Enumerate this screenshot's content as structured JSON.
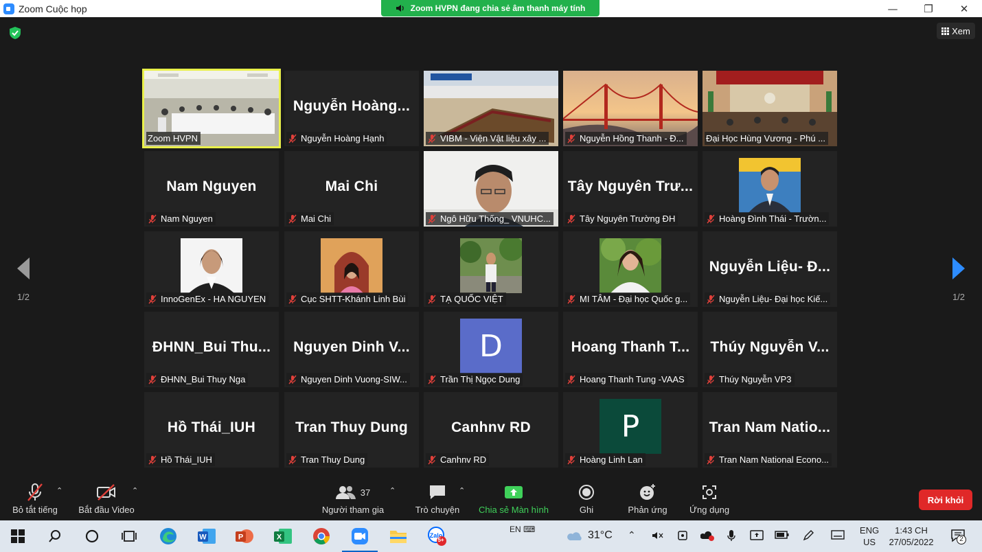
{
  "window": {
    "title": "Zoom Cuộc họp"
  },
  "banner": {
    "text": "Zoom HVPN đang chia sẻ âm thanh máy tính"
  },
  "view": {
    "label": "Xem"
  },
  "pager": {
    "left": "1/2",
    "right": "1/2"
  },
  "tiles": [
    {
      "big": "",
      "label": "Zoom HVPN",
      "muted": false
    },
    {
      "big": "Nguyễn  Hoàng...",
      "label": "Nguyễn Hoàng Hạnh",
      "muted": true
    },
    {
      "big": "",
      "label": "VIBM - Viện Vật liệu xây ...",
      "muted": true
    },
    {
      "big": "",
      "label": "Nguyễn Hồng Thanh - Đ...",
      "muted": true
    },
    {
      "big": "",
      "label": "Đại Học Hùng Vương - Phú ...",
      "muted": false
    },
    {
      "big": "Nam Nguyen",
      "label": "Nam Nguyen",
      "muted": true
    },
    {
      "big": "Mai Chi",
      "label": "Mai Chi",
      "muted": true
    },
    {
      "big": "",
      "label": "Ngô Hữu Thống_ VNUHC...",
      "muted": true
    },
    {
      "big": "Tây  Nguyên  Trư...",
      "label": "Tây Nguyên Trường ĐH",
      "muted": true
    },
    {
      "big": "",
      "label": "Hoàng Đình Thái - Trườn...",
      "muted": true
    },
    {
      "big": "",
      "label": "InnoGenEx - HA NGUYEN",
      "muted": true
    },
    {
      "big": "",
      "label": "Cục SHTT-Khánh Linh Bùi",
      "muted": true
    },
    {
      "big": "",
      "label": "TẠ QUỐC VIỆT",
      "muted": true
    },
    {
      "big": "",
      "label": "MI TÂM - Đại học Quốc g...",
      "muted": true
    },
    {
      "big": "Nguyễn  Liệu-  Đ...",
      "label": "Nguyễn Liệu- Đại học Kiế...",
      "muted": true
    },
    {
      "big": "ĐHNN_Bui  Thu...",
      "label": "ĐHNN_Bui Thuy Nga",
      "muted": true
    },
    {
      "big": "Nguyen  Dinh  V...",
      "label": "Nguyen Dinh Vuong-SIW...",
      "muted": true
    },
    {
      "big": "",
      "letter": "D",
      "label": "Trần Thị Ngọc Dung",
      "muted": true
    },
    {
      "big": "Hoang  Thanh  T...",
      "label": "Hoang Thanh Tung -VAAS",
      "muted": true
    },
    {
      "big": "Thúy  Nguyễn  V...",
      "label": "Thúy Nguyễn VP3",
      "muted": true
    },
    {
      "big": "Hồ Thái_IUH",
      "label": "Hồ Thái_IUH",
      "muted": true
    },
    {
      "big": "Tran Thuy Dung",
      "label": "Tran Thuy Dung",
      "muted": true
    },
    {
      "big": "Canhnv RD",
      "label": "Canhnv RD",
      "muted": true
    },
    {
      "big": "",
      "letter": "P",
      "label": "Hoàng Linh Lan",
      "muted": true
    },
    {
      "big": "Tran  Nam  Natio...",
      "label": "Tran Nam National Econo...",
      "muted": true
    }
  ],
  "toolbar": {
    "mute": "Bỏ tắt tiếng",
    "video": "Bắt đầu Video",
    "participants": "Người tham gia",
    "participants_count": "37",
    "chat": "Trò chuyện",
    "share": "Chia sẻ Màn hình",
    "record": "Ghi",
    "reactions": "Phản ứng",
    "apps": "Ứng dụng",
    "leave": "Rời khỏi"
  },
  "taskbar": {
    "lang_input": "EN",
    "weather": "31°C",
    "lang": "ENG",
    "region": "US",
    "time": "1:43 CH",
    "date": "27/05/2022",
    "notifications": "2",
    "zalo_badge": "5+"
  },
  "colors": {
    "accent": "#2d8cff",
    "share_green": "#22b14c",
    "leave_red": "#e02828",
    "active_border": "#e9f04a",
    "avatar_d": "#5a6cc9",
    "avatar_p": "#0b4a3a"
  }
}
